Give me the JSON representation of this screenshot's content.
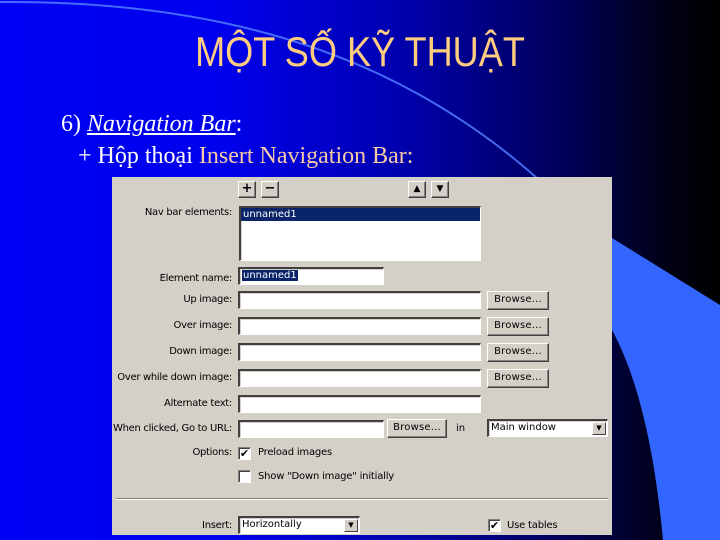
{
  "slide": {
    "title": "MỘT SỐ KỸ THUẬT",
    "bullet1_prefix": "6) ",
    "bullet1_term": "Navigation Bar",
    "bullet1_suffix": ":",
    "bullet2_prefix": "+ Hộp thoại ",
    "bullet2_highlight": "Insert Navigation Bar:"
  },
  "colors": {
    "title": "#ffcc80",
    "highlight": "#f7c9a6",
    "dialog_bg": "#d4d0c8",
    "selection": "#0a246a",
    "accent_shape": "#3366ff"
  },
  "dialog": {
    "toolbar": {
      "add_icon": "plus-icon",
      "add_glyph": "+",
      "remove_icon": "minus-icon",
      "remove_glyph": "−",
      "move_up_icon": "arrow-up-icon",
      "move_up_glyph": "▲",
      "move_down_icon": "arrow-down-icon",
      "move_down_glyph": "▼"
    },
    "nav_bar_elements": {
      "label": "Nav bar elements:",
      "items": [
        "unnamed1"
      ],
      "selected_index": 0
    },
    "element_name": {
      "label": "Element name:",
      "value": "unnamed1"
    },
    "up_image": {
      "label": "Up image:",
      "value": "",
      "browse": "Browse..."
    },
    "over_image": {
      "label": "Over image:",
      "value": "",
      "browse": "Browse..."
    },
    "down_image": {
      "label": "Down image:",
      "value": "",
      "browse": "Browse..."
    },
    "over_while_down_image": {
      "label": "Over while down image:",
      "value": "",
      "browse": "Browse..."
    },
    "alternate_text": {
      "label": "Alternate text:",
      "value": ""
    },
    "go_to_url": {
      "label": "When clicked, Go to URL:",
      "value": "",
      "browse": "Browse...",
      "in_label": "in",
      "target_selected": "Main window"
    },
    "options": {
      "label": "Options:",
      "preload_images": {
        "label": "Preload images",
        "checked": true
      },
      "show_down_initially": {
        "label": "Show \"Down image\" initially",
        "checked": false
      }
    },
    "insert": {
      "label": "Insert:",
      "selected": "Horizontally"
    },
    "use_tables": {
      "label": "Use tables",
      "checked": true
    },
    "check_glyph": "✔",
    "dropdown_glyph": "▼"
  }
}
